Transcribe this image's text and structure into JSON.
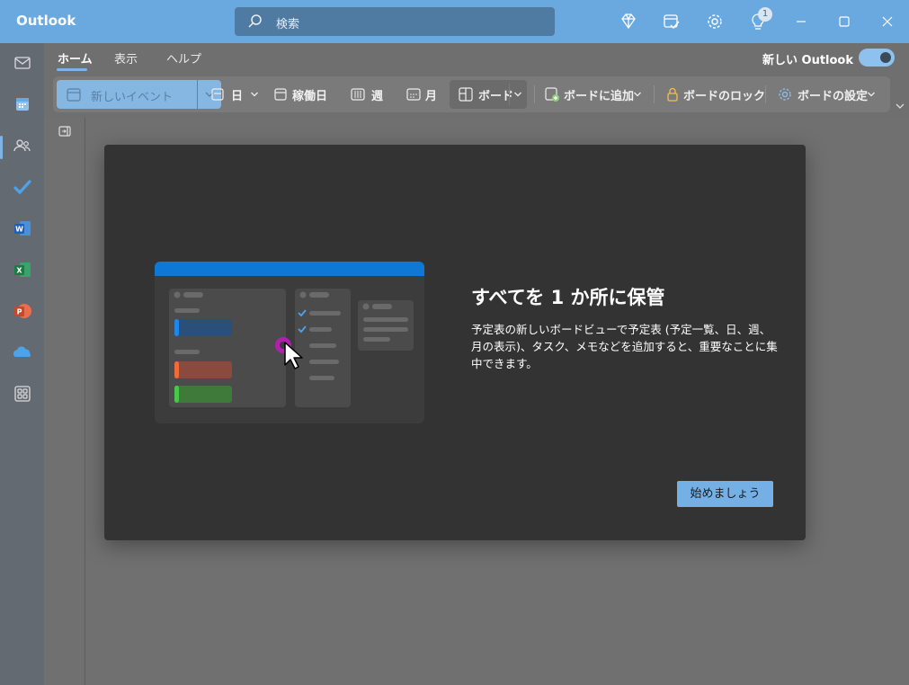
{
  "titlebar": {
    "app_title": "Outlook",
    "search_placeholder": "検索",
    "notification_count": "1"
  },
  "nav": {
    "tabs": [
      {
        "label": "ホーム",
        "selected": true
      },
      {
        "label": "表示",
        "selected": false
      },
      {
        "label": "ヘルプ",
        "selected": false
      }
    ],
    "new_outlook_label": "新しい Outlook",
    "new_outlook_toggle_on": true
  },
  "ribbon": {
    "new_event": "新しいイベント",
    "day": "日",
    "work_week": "稼働日",
    "week": "週",
    "month": "月",
    "board": "ボード",
    "add_to_board": "ボードに追加",
    "lock_board": "ボードのロック",
    "board_settings": "ボードの設定"
  },
  "dialog": {
    "title": "すべてを 1 か所に保管",
    "body": "予定表の新しいボードビューで予定表 (予定一覧、日、週、月の表示)、タスク、メモなどを追加すると、重要なことに集中できます。",
    "start_button": "始めましょう"
  },
  "colors": {
    "titlebar": "#6aa8e0",
    "accent": "#74b0e6",
    "dialog_bg": "#333333",
    "illus_header": "#0f78d4",
    "illus_blue": "#2a4f78",
    "illus_red": "#8a4a3e",
    "illus_green": "#3f7a3a",
    "cursor_ring": "#b21fb0"
  },
  "rail_icons": [
    "mail-icon",
    "calendar-icon",
    "people-icon",
    "todo-icon",
    "word-icon",
    "excel-icon",
    "powerpoint-icon",
    "onedrive-icon",
    "apps-icon"
  ]
}
